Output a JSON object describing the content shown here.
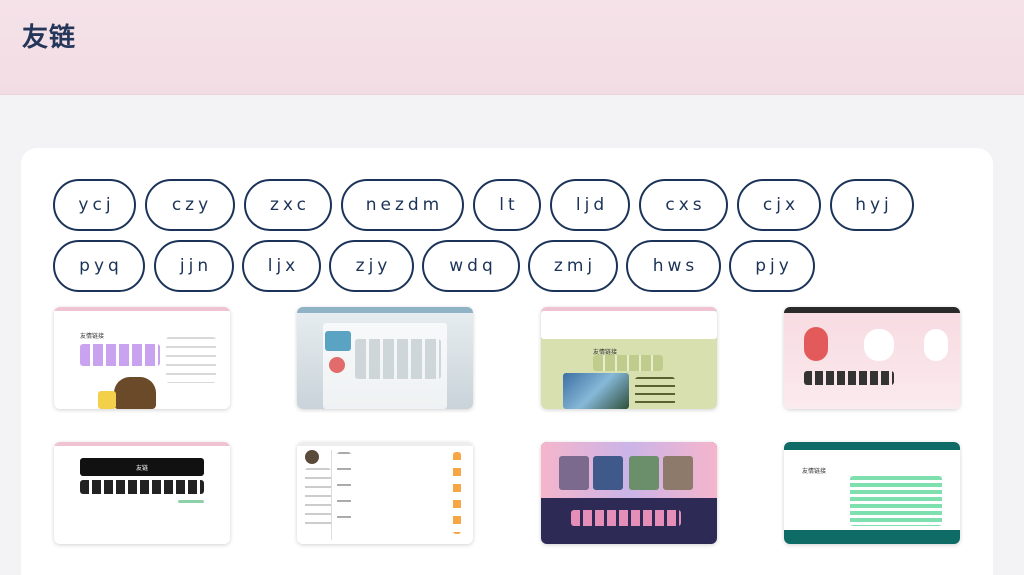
{
  "page": {
    "title": "友链"
  },
  "links": [
    {
      "label": "ycj"
    },
    {
      "label": "czy"
    },
    {
      "label": "zxc"
    },
    {
      "label": "nezdm"
    },
    {
      "label": "lt"
    },
    {
      "label": "ljd"
    },
    {
      "label": "cxs"
    },
    {
      "label": "cjx"
    },
    {
      "label": "hyj"
    },
    {
      "label": "pyq"
    },
    {
      "label": "jjn"
    },
    {
      "label": "ljx"
    },
    {
      "label": "zjy"
    },
    {
      "label": "wdq"
    },
    {
      "label": "zmj"
    },
    {
      "label": "hws"
    },
    {
      "label": "pjy"
    }
  ],
  "thumbnails": [
    {
      "name": "site-preview-1",
      "caption": "友情链接",
      "accent": "#c9a3f0"
    },
    {
      "name": "site-preview-2",
      "caption": "",
      "accent": "#8fb3c4"
    },
    {
      "name": "site-preview-3",
      "caption": "友情链接",
      "accent": "#c0cc8c"
    },
    {
      "name": "site-preview-4",
      "caption": "",
      "accent": "#f2c5cd"
    },
    {
      "name": "site-preview-5",
      "caption": "友链",
      "accent": "#111111"
    },
    {
      "name": "site-preview-6",
      "caption": "",
      "accent": "#f7a646"
    },
    {
      "name": "site-preview-7",
      "caption": "",
      "accent": "#2d2b55"
    },
    {
      "name": "site-preview-8",
      "caption": "友情链接",
      "accent": "#7ee0ae"
    }
  ],
  "colors": {
    "accent": "#1b3358",
    "header_bg": "#f5e1e8",
    "page_bg": "#f3f3f5"
  }
}
